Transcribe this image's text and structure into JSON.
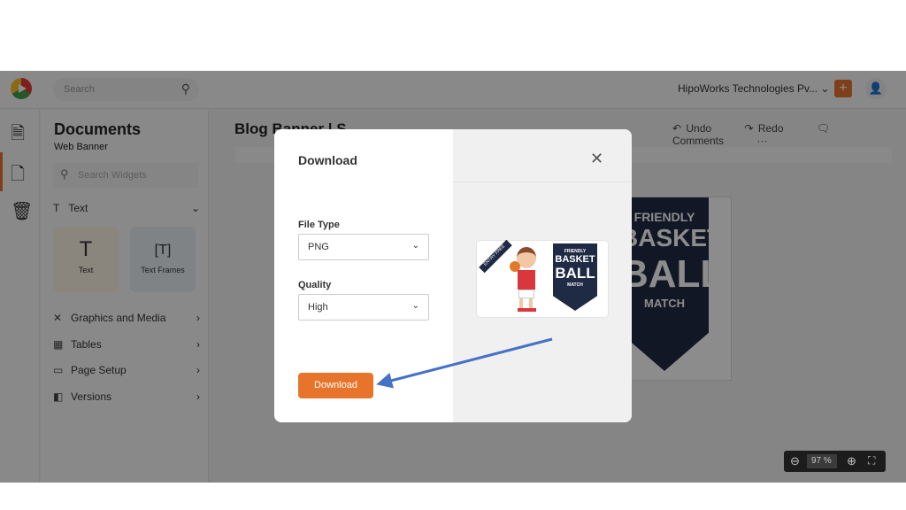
{
  "topbar": {
    "search_placeholder": "Search",
    "org": "HipoWorks Technologies Pv...",
    "plus": "+"
  },
  "panel": {
    "title": "Documents",
    "subtitle": "Web Banner",
    "search_placeholder": "Search Widgets",
    "section": "Text",
    "tiles": [
      {
        "label": "Text"
      },
      {
        "label": "Text Frames"
      }
    ],
    "nav": [
      {
        "label": "Graphics and Media"
      },
      {
        "label": "Tables"
      },
      {
        "label": "Page Setup"
      },
      {
        "label": "Versions"
      }
    ]
  },
  "main": {
    "doc_title": "Blog Banner | S",
    "undo": "Undo",
    "redo": "Redo",
    "comments": "Comments",
    "more": "···"
  },
  "banner": {
    "l1": "FRIENDLY",
    "l2": "BASKET",
    "l3": "BALL",
    "l4": "MATCH"
  },
  "zoom": {
    "value": "97",
    "unit": "%"
  },
  "dialog": {
    "title": "Download",
    "file_type_label": "File Type",
    "file_type": "PNG",
    "quality_label": "Quality",
    "quality": "High",
    "download": "Download",
    "preview": {
      "ribbon": "ENTRY FREE",
      "l1": "FRIENDLY",
      "l2": "BASKET",
      "l3": "BALL",
      "l4": "MATCH"
    }
  },
  "colors": {
    "accent": "#e8742c",
    "arrow": "#4472c4",
    "navy": "#1f2a44"
  }
}
